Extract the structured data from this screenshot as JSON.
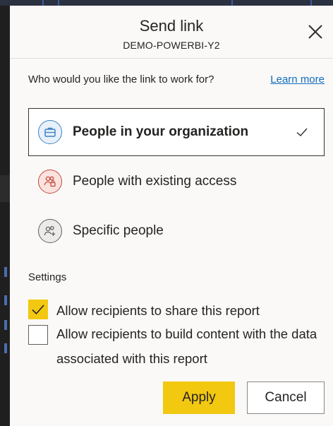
{
  "dialog": {
    "title": "Send link",
    "subtitle": "DEMO-POWERBI-Y2",
    "question": "Who would you like the link to work for?",
    "learn_more": "Learn more"
  },
  "options": [
    {
      "label": "People in your organization",
      "icon": "briefcase-icon",
      "selected": true
    },
    {
      "label": "People with existing access",
      "icon": "people-lock-icon",
      "selected": false
    },
    {
      "label": "Specific people",
      "icon": "people-add-icon",
      "selected": false
    }
  ],
  "settings": {
    "label": "Settings",
    "checkboxes": [
      {
        "label": "Allow recipients to share this report",
        "checked": true
      },
      {
        "label": "Allow recipients to build content with the data associated with this report",
        "checked": false
      }
    ]
  },
  "buttons": {
    "apply": "Apply",
    "cancel": "Cancel"
  },
  "colors": {
    "accent": "#f2c811",
    "link": "#0f6cbd",
    "dialog_bg": "#faf9f8",
    "org_icon": "#3b82c4",
    "existing_icon": "#c4493c",
    "specific_icon": "#605e5c"
  }
}
